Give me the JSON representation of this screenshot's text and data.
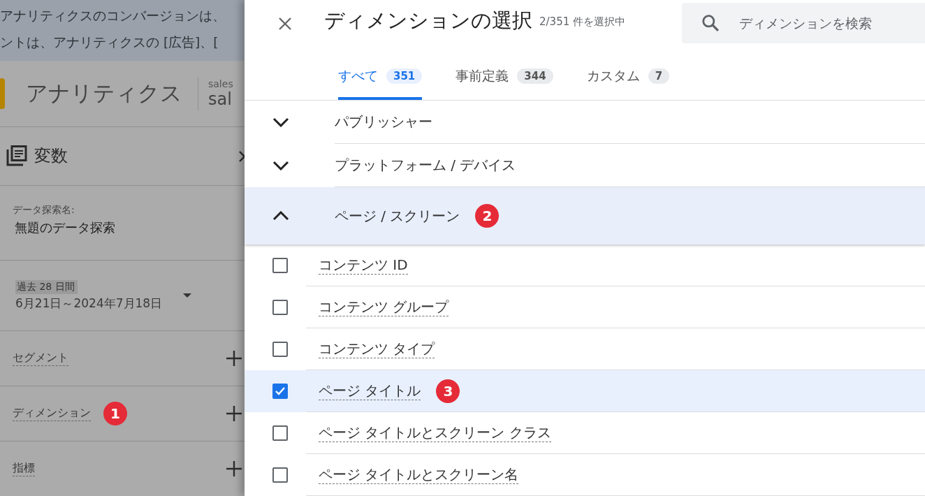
{
  "banner": {
    "lines": [
      "アナリティクスのコンバージョンは、",
      "ントは、アナリティクスの [広告]、["
    ]
  },
  "app": {
    "title": "アナリティクス",
    "account": "sales",
    "property": "sal"
  },
  "variables": {
    "title": "変数"
  },
  "exploration_name": {
    "label": "データ探索名:",
    "value": "無題のデータ探索"
  },
  "date_range": {
    "preset": "過去 28 日間",
    "range": "6月21日～2024年7月18日"
  },
  "sections": [
    {
      "label": "セグメント"
    },
    {
      "label": "ディメンション",
      "badge": "1"
    },
    {
      "label": "指標"
    }
  ],
  "dialog": {
    "title": "ディメンションの選択",
    "subtitle": "2/351 件を選択中",
    "search": {
      "placeholder": "ディメンションを検索"
    },
    "tabs": [
      {
        "label": "すべて",
        "count": "351",
        "selected": true
      },
      {
        "label": "事前定義",
        "count": "344",
        "selected": false
      },
      {
        "label": "カスタム",
        "count": "7",
        "selected": false
      }
    ],
    "groups": [
      {
        "label": "パブリッシャー",
        "expanded": false
      },
      {
        "label": "プラットフォーム / デバイス",
        "expanded": false
      },
      {
        "label": "ページ / スクリーン",
        "expanded": true,
        "badge": "2",
        "items": [
          {
            "label": "コンテンツ ID",
            "checked": false
          },
          {
            "label": "コンテンツ グループ",
            "checked": false
          },
          {
            "label": "コンテンツ タイプ",
            "checked": false
          },
          {
            "label": "ページ タイトル",
            "checked": true,
            "badge": "3"
          },
          {
            "label": "ページ タイトルとスクリーン クラス",
            "checked": false
          },
          {
            "label": "ページ タイトルとスクリーン名",
            "checked": false
          }
        ]
      }
    ]
  }
}
